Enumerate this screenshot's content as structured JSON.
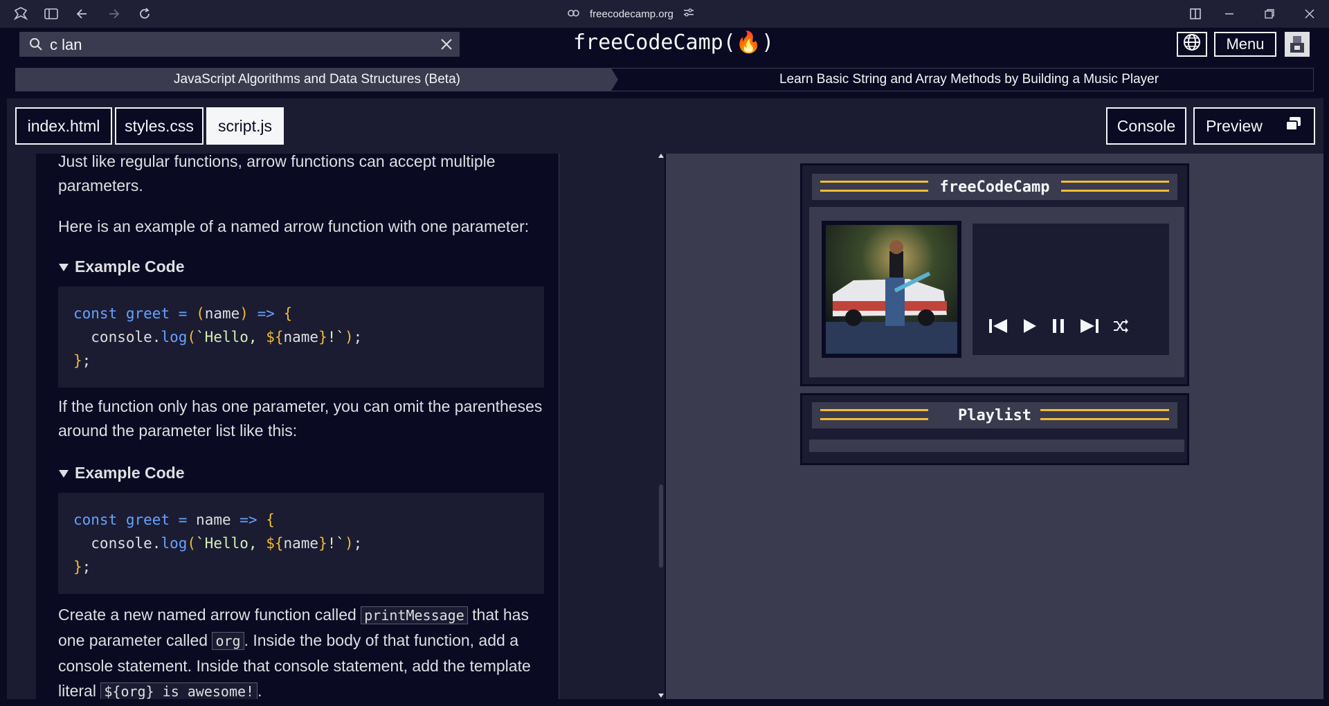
{
  "browser": {
    "url": "freecodecamp.org"
  },
  "nav": {
    "search_value": "c lan",
    "logo": "freeCodeCamp(🔥)",
    "menu_label": "Menu"
  },
  "breadcrumb": {
    "superblock": "JavaScript Algorithms and Data Structures (Beta)",
    "block": "Learn Basic String and Array Methods by Building a Music Player"
  },
  "tabs": {
    "files": [
      "index.html",
      "styles.css",
      "script.js"
    ],
    "active": "script.js",
    "console_label": "Console",
    "preview_label": "Preview"
  },
  "instructions": {
    "p1": "Just like regular functions, arrow functions can accept multiple parameters.",
    "p2": "Here is an example of a named arrow function with one parameter:",
    "summary1": "Example Code",
    "p3": "If the function only has one parameter, you can omit the parentheses around the parameter list like this:",
    "summary2": "Example Code",
    "task_part1": "Create a new named arrow function called ",
    "task_code1": "printMessage",
    "task_part2": " that has one parameter called ",
    "task_code2": "org",
    "task_part3": ". Inside the body of that function, add a console statement. Inside that console statement, add the template literal ",
    "task_code3": "${org} is awesome!",
    "task_part4": "."
  },
  "preview": {
    "player_title": "freeCodeCamp",
    "playlist_title": "Playlist"
  },
  "colors": {
    "bg_dark": "#0a0a23",
    "bg_mid": "#1b1b32",
    "bg_gray": "#3b3b4f",
    "accent_yellow": "#f1be32",
    "code_blue": "#66a3ff"
  }
}
